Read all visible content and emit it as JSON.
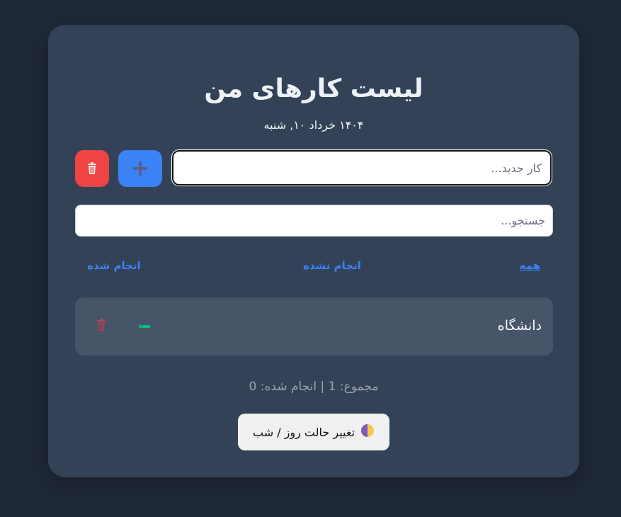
{
  "header": {
    "title": "لیست کارهای من",
    "date": "۱۴۰۴ خرداد ۱۰, شنبه"
  },
  "new_task": {
    "placeholder": "کار جدید...",
    "value": ""
  },
  "search": {
    "placeholder": "جستجو...",
    "value": ""
  },
  "buttons": {
    "add_icon": "plus-icon",
    "clear_icon": "trash-icon"
  },
  "filters": [
    {
      "label": "همه",
      "active": true
    },
    {
      "label": "انجام نشده",
      "active": false
    },
    {
      "label": "انجام شده",
      "active": false
    }
  ],
  "tasks": [
    {
      "text": "دانشگاه",
      "done": false,
      "toggle_icon": "pen-icon",
      "delete_icon": "trash-icon"
    }
  ],
  "stats": "مجموع: 1 | انجام شده: 0",
  "theme_toggle": {
    "label": "تغییر حالت روز / شب",
    "icon": "half-moon-icon"
  },
  "colors": {
    "background": "#1f2838",
    "card": "#344257",
    "accent": "#3b82f6",
    "danger": "#ef4444",
    "task_row": "#475569",
    "success": "#10b981"
  }
}
